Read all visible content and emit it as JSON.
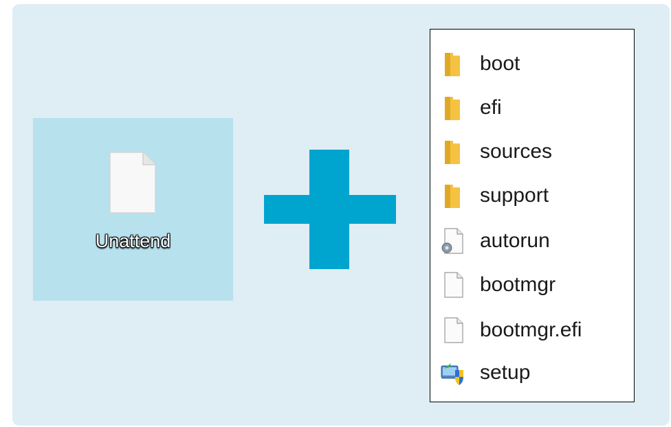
{
  "desktop": {
    "file_label": "Unattend"
  },
  "plus_color": "#00a5cf",
  "folder_color": "#f5c242",
  "file_list": {
    "items": [
      {
        "label": "boot",
        "icon": "folder-icon"
      },
      {
        "label": "efi",
        "icon": "folder-icon"
      },
      {
        "label": "sources",
        "icon": "folder-icon"
      },
      {
        "label": "support",
        "icon": "folder-icon"
      },
      {
        "label": "autorun",
        "icon": "settings-file-icon"
      },
      {
        "label": "bootmgr",
        "icon": "blank-file-icon"
      },
      {
        "label": "bootmgr.efi",
        "icon": "blank-file-icon"
      },
      {
        "label": "setup",
        "icon": "setup-shield-icon"
      }
    ]
  }
}
